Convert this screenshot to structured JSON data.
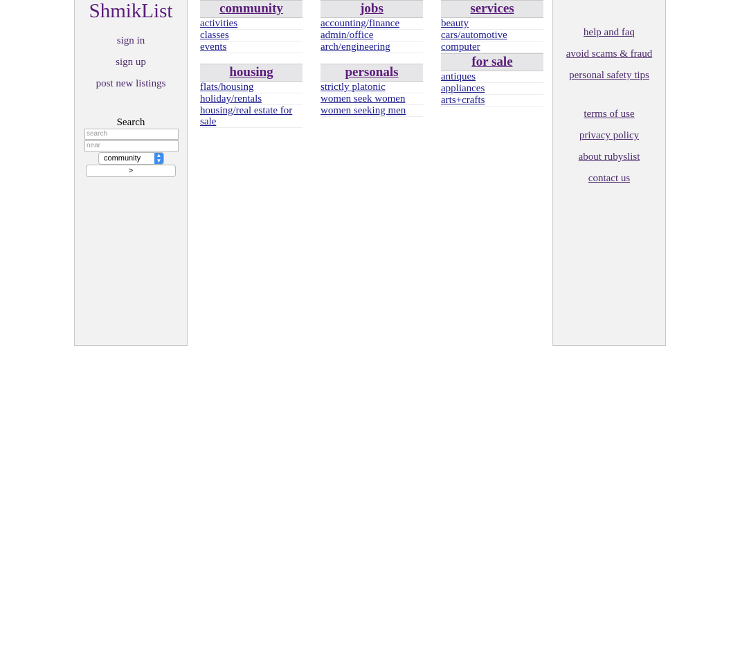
{
  "site": {
    "logo": "ShmikList"
  },
  "left_nav": {
    "sign_in": "sign in",
    "sign_up": "sign up",
    "post": "post new listings"
  },
  "search": {
    "title": "Search",
    "query_placeholder": "search",
    "near_placeholder": "near",
    "category_selected": "community",
    "go_label": ">"
  },
  "categories": {
    "community": {
      "title": "community",
      "items": [
        "activities",
        "classes",
        "events"
      ]
    },
    "jobs": {
      "title": "jobs",
      "items": [
        "accounting/finance",
        "admin/office",
        "arch/engineering"
      ]
    },
    "services": {
      "title": "services",
      "items": [
        "beauty",
        "cars/automotive",
        "computer"
      ]
    },
    "housing": {
      "title": "housing",
      "items": [
        "flats/housing",
        "holiday/rentals",
        "housing/real estate for sale"
      ]
    },
    "personals": {
      "title": "personals",
      "items": [
        "strictly platonic",
        "women seek women",
        "women seeking men"
      ]
    },
    "for_sale": {
      "title": "for sale",
      "items": [
        "antiques",
        "appliances",
        "arts+crafts"
      ]
    }
  },
  "right_nav": {
    "help": "help and faq",
    "scams": "avoid scams & fraud",
    "safety": "personal safety tips",
    "terms": "terms of use",
    "privacy": "privacy policy",
    "about": "about rubyslist",
    "contact": "contact us"
  },
  "colors": {
    "link_visited": "#5a1c7a",
    "link": "#1a1a8c",
    "sidebar_bg": "#f2f2f3",
    "header_bg": "#e6e6e8",
    "select_accent": "#3d8df0"
  }
}
